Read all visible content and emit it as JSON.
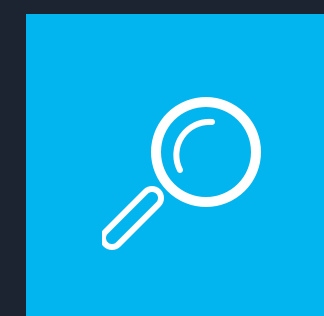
{
  "colors": {
    "background": "#1b2430",
    "tile": "#03b5ef",
    "icon": "#ffffff"
  },
  "search_tile": {
    "icon": "search-icon"
  }
}
